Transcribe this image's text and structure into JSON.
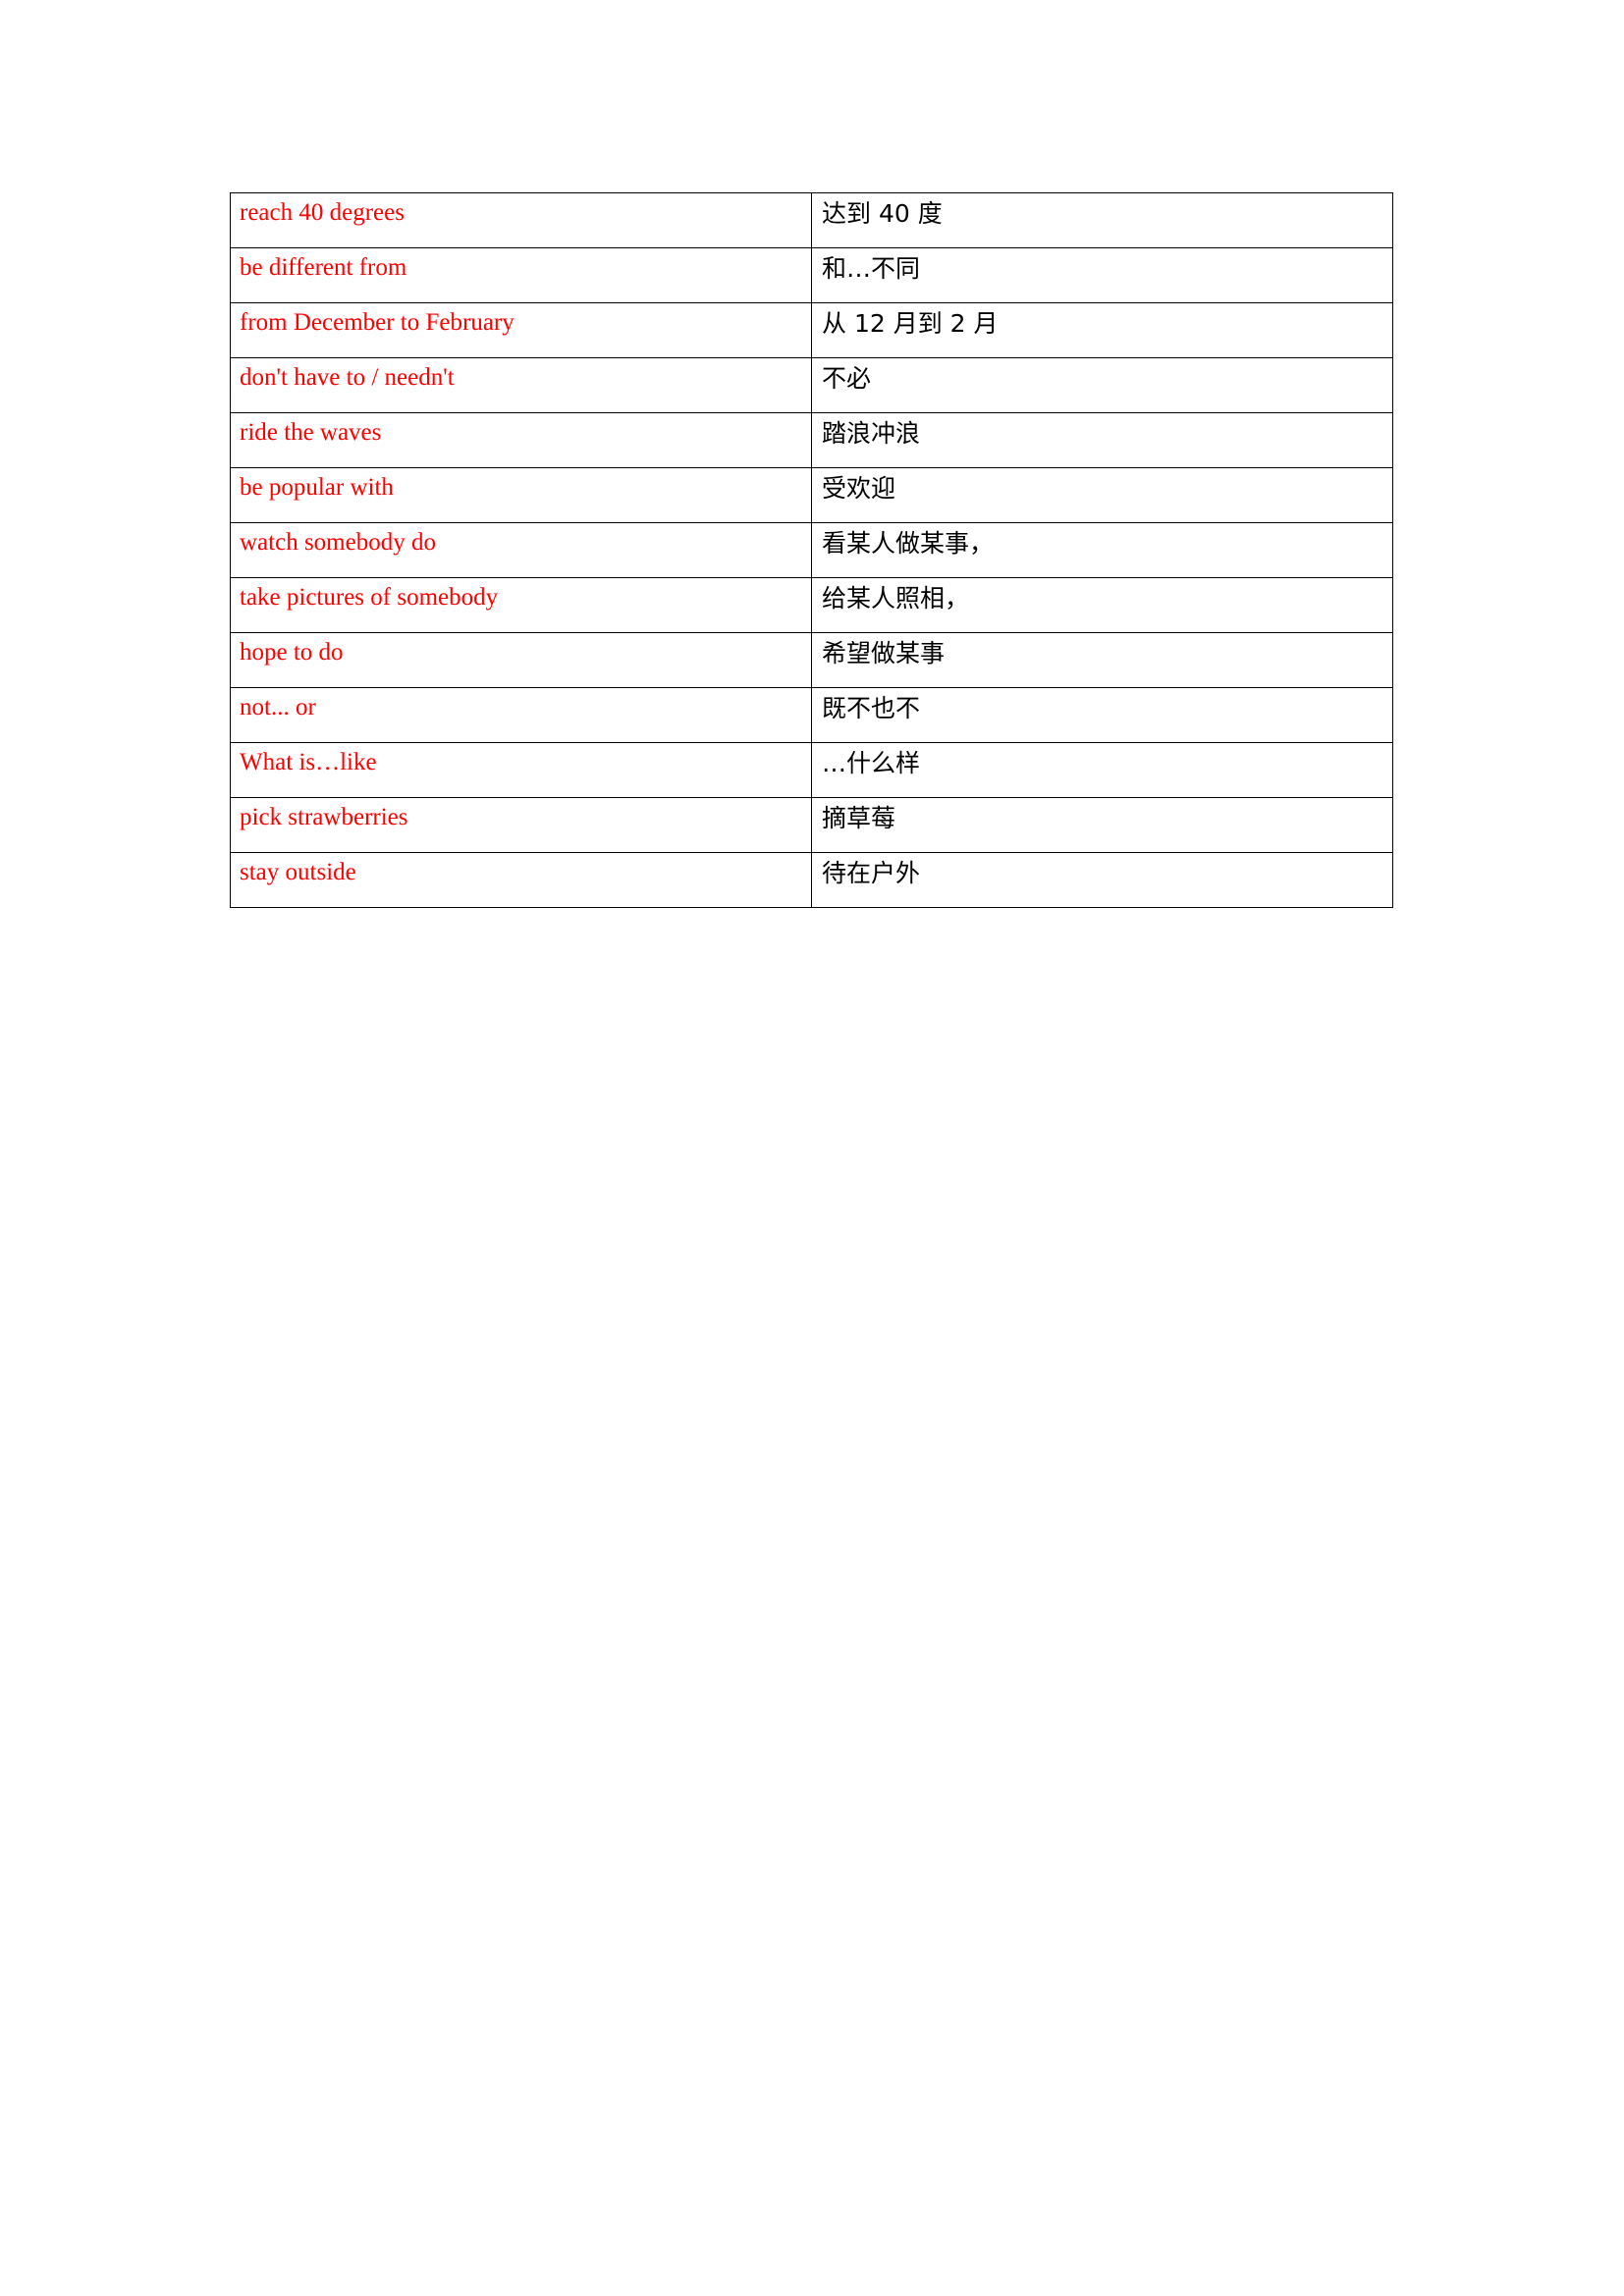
{
  "document": {
    "type": "vocabulary-table",
    "page_background": "#ffffff",
    "english_text_color": "#FF0000",
    "chinese_text_color": "#000000",
    "border_color": "#000000"
  },
  "table": {
    "columns": [
      {
        "key": "english",
        "language": "en"
      },
      {
        "key": "chinese",
        "language": "zh"
      }
    ],
    "rows": [
      {
        "english": "reach 40 degrees",
        "chinese": "达到 40 度"
      },
      {
        "english": "be different from",
        "chinese": "和…不同"
      },
      {
        "english": "from December to February",
        "chinese": "从 12 月到 2 月"
      },
      {
        "english": "don't have to / needn't",
        "chinese": "不必"
      },
      {
        "english": "ride the waves",
        "chinese": "踏浪冲浪"
      },
      {
        "english": "be popular with",
        "chinese": "受欢迎"
      },
      {
        "english": "watch somebody do",
        "chinese": "看某人做某事，"
      },
      {
        "english": "take pictures of somebody",
        "chinese": "给某人照相，"
      },
      {
        "english": "hope to do",
        "chinese": "希望做某事"
      },
      {
        "english": "not... or",
        "chinese": "既不也不"
      },
      {
        "english": "What is…like",
        "chinese": "…什么样"
      },
      {
        "english": "pick strawberries",
        "chinese": "摘草莓"
      },
      {
        "english": "stay outside",
        "chinese": "待在户外"
      }
    ]
  }
}
